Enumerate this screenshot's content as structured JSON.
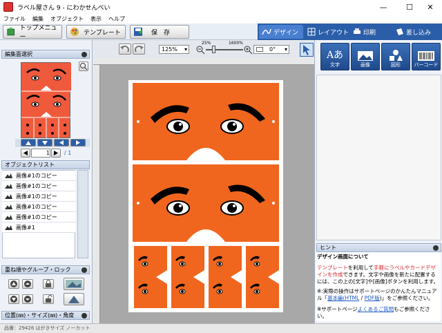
{
  "window": {
    "title": "ラベル屋さん 9 - にわかせんべい",
    "minimize": "—",
    "maximize": "☐",
    "close": "✕"
  },
  "menu": [
    "ファイル",
    "編集",
    "オブジェクト",
    "表示",
    "ヘルプ"
  ],
  "toolbar": {
    "top_menu": "トップメニュー",
    "template": "テンプレート",
    "save": "保　存"
  },
  "modes": [
    "デザイン",
    "レイアウト",
    "印刷",
    "差し込み"
  ],
  "left": {
    "edit_select": "編集面選択",
    "page_value": "1",
    "page_total": "/ 1",
    "object_list": "オブジェクトリスト",
    "objects": [
      "画像#1のコピー",
      "画像#1のコピー",
      "画像#1のコピー",
      "画像#1のコピー",
      "画像#1のコピー",
      "画像#1"
    ],
    "order_group": "重ね順やグループ・ロック",
    "position_size": "位置(㎜)・サイズ(㎜)・角度"
  },
  "controls": {
    "zoom": "125%",
    "zoom_min": "25%",
    "zoom_max": "1600%",
    "angle": "0°"
  },
  "tools": [
    "文字",
    "画像",
    "図形",
    "バーコード"
  ],
  "hint": {
    "header": "ヒント",
    "title": "デザイン画面について",
    "p1_a": "テンプレート",
    "p1_b": "を利用して",
    "p1_c": "手軽にラベルやカードデザインを作成",
    "p1_d": "できます。文字や画像を新たに配置するには、この上の[文字]や[画像]ボタンを利用します。",
    "p2_a": "※:実際の操作はサポートページのかんたんマニュアル「",
    "p2_b": "基本編(HTML",
    "p2_c": " / ",
    "p2_d": "PDF版",
    "p2_e": ")」をご参照ください。",
    "p3_a": "※サポートページ",
    "p3_b": "よくあるご質問",
    "p3_c": "もご参照ください。"
  },
  "status": "品番：29426 はがきサイズ ノーカット",
  "colors": {
    "card": "#f0661e",
    "accent": "#2b5ea8"
  }
}
